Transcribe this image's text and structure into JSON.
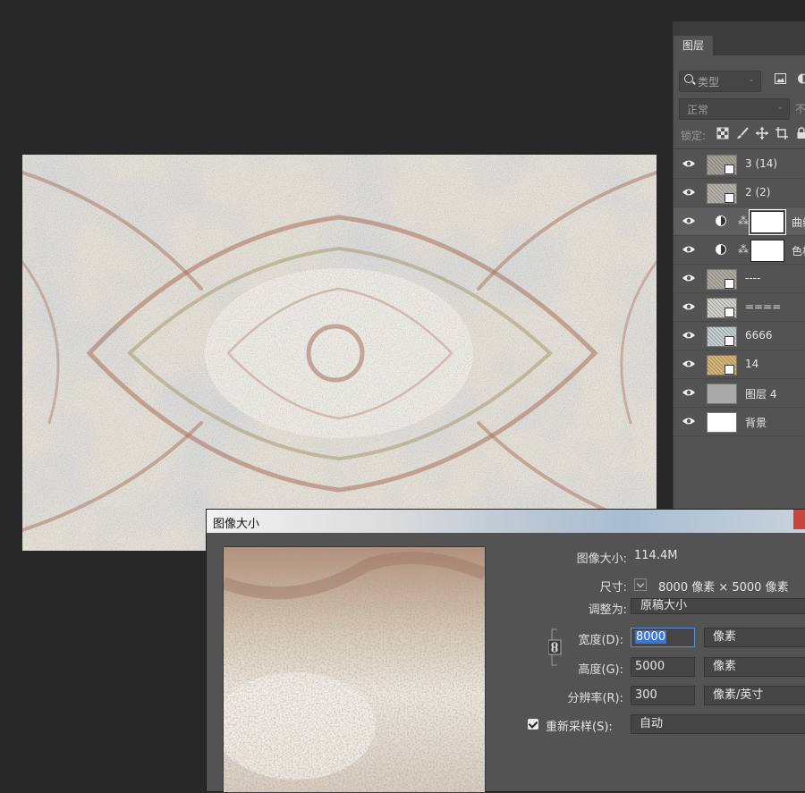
{
  "layers_panel": {
    "tab": "图层",
    "filter_label": "类型",
    "blend_mode": "正常",
    "opacity_label": "不",
    "lock_label": "锁定:",
    "layers": [
      {
        "name": "3 (14)",
        "kind": "smart",
        "thumb": "#a8a49c"
      },
      {
        "name": "2 (2)",
        "kind": "smart",
        "thumb": "#b8b5ae"
      },
      {
        "name": "曲线",
        "kind": "adjustment",
        "selected": true
      },
      {
        "name": "色相",
        "kind": "adjustment"
      },
      {
        "name": "----",
        "kind": "smart",
        "thumb": "#b2ada5"
      },
      {
        "name": "====",
        "kind": "smart",
        "thumb": "#d6d4d0"
      },
      {
        "name": "6666",
        "kind": "smart",
        "thumb": "#c9d3d6"
      },
      {
        "name": "14",
        "kind": "smart",
        "thumb": "#d9b878"
      },
      {
        "name": "图层 4",
        "kind": "fill",
        "thumb": "#a9a9a9"
      },
      {
        "name": "背景",
        "kind": "fill",
        "thumb": "#ffffff"
      }
    ]
  },
  "dialog": {
    "title": "图像大小",
    "image_size_label": "图像大小:",
    "image_size_value": "114.4M",
    "dimensions_label": "尺寸:",
    "dimensions_value": "8000 像素 × 5000 像素",
    "fit_to_label": "调整为:",
    "fit_to_value": "原稿大小",
    "width_label": "宽度(D):",
    "width_value": "8000",
    "width_unit": "像素",
    "height_label": "高度(G):",
    "height_value": "5000",
    "height_unit": "像素",
    "resolution_label": "分辨率(R):",
    "resolution_value": "300",
    "resolution_unit": "像素/英寸",
    "resample_label": "重新采样(S):",
    "resample_checked": true,
    "resample_value": "自动"
  }
}
